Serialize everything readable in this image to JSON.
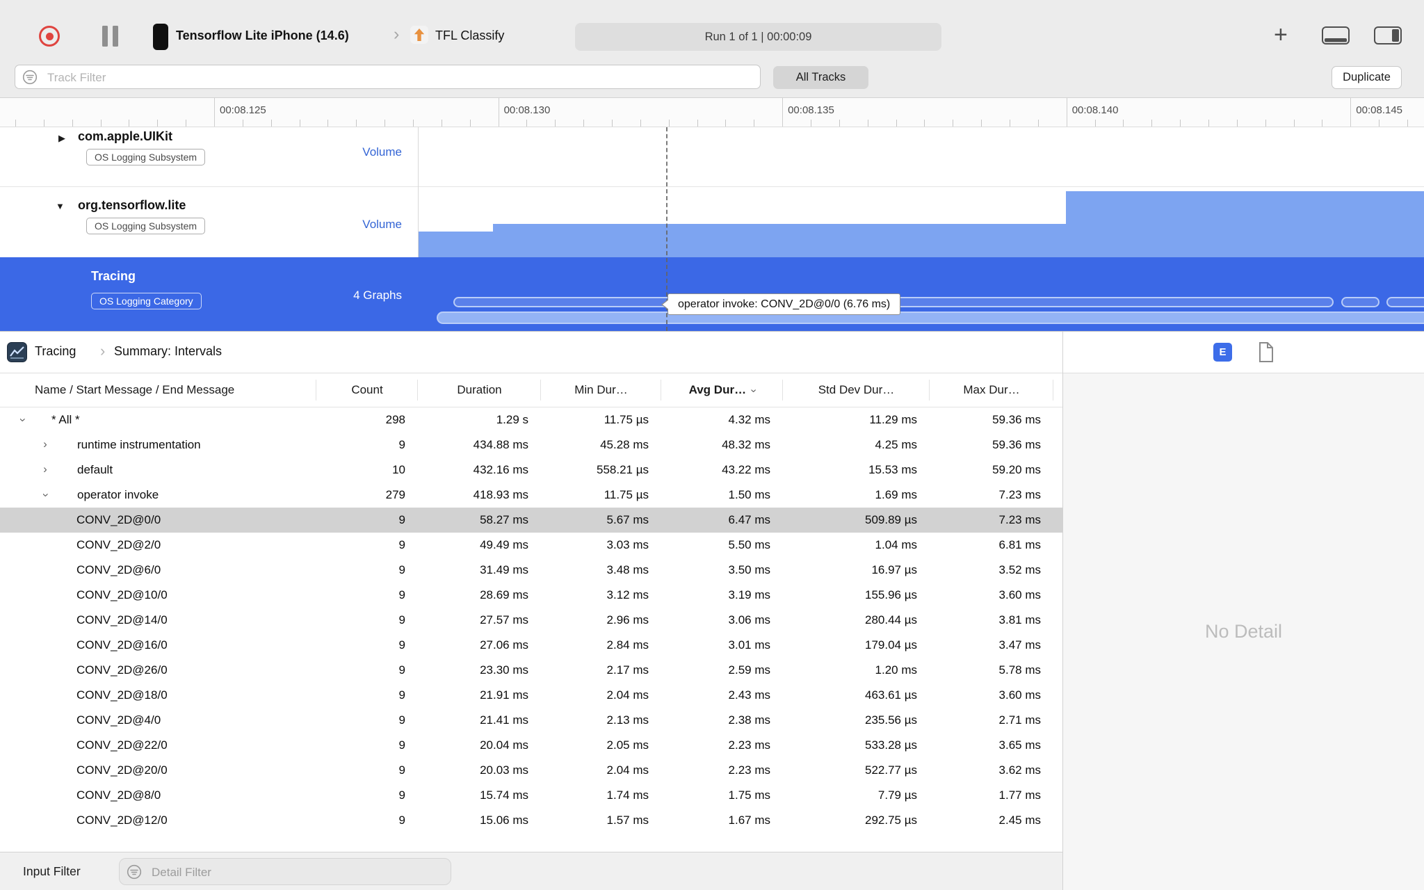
{
  "toolbar": {
    "device_name": "Tensorflow Lite iPhone (14.6)",
    "target_name": "TFL Classify",
    "run_status": "Run 1 of 1   |   00:00:09"
  },
  "filter_bar": {
    "track_filter_placeholder": "Track Filter",
    "all_tracks_label": "All Tracks",
    "duplicate_label": "Duplicate"
  },
  "ruler": {
    "labels": [
      "00:08.125",
      "00:08.130",
      "00:08.135",
      "00:08.140",
      "00:08.145"
    ]
  },
  "tracks": [
    {
      "name": "com.apple.UIKit",
      "badge": "OS Logging Subsystem",
      "meta": "Volume",
      "state": "collapsed",
      "selected": false
    },
    {
      "name": "org.tensorflow.lite",
      "badge": "OS Logging Subsystem",
      "meta": "Volume",
      "state": "expanded",
      "selected": false
    },
    {
      "name": "Tracing",
      "badge": "OS Logging Category",
      "meta": "4 Graphs",
      "state": "none",
      "selected": true
    }
  ],
  "timeline_tooltip": "operator invoke: CONV_2D@0/0 (6.76 ms)",
  "detail_pane": {
    "breadcrumb": {
      "instrument": "Tracing",
      "page": "Summary: Intervals"
    },
    "extended_detail_button": "E",
    "no_detail_text": "No Detail"
  },
  "table": {
    "columns": [
      "Name / Start Message / End Message",
      "Count",
      "Duration",
      "Min Dur…",
      "Avg Dur…",
      "Std Dev Dur…",
      "Max Dur…"
    ],
    "sorted_column_index": 4,
    "rows": [
      {
        "name": "* All *",
        "level": 0,
        "disclosure": "open",
        "selected": false,
        "values": [
          "298",
          "1.29 s",
          "11.75 µs",
          "4.32 ms",
          "11.29 ms",
          "59.36 ms"
        ]
      },
      {
        "name": "runtime instrumentation",
        "level": 1,
        "disclosure": "closed",
        "selected": false,
        "values": [
          "9",
          "434.88 ms",
          "45.28 ms",
          "48.32 ms",
          "4.25 ms",
          "59.36 ms"
        ]
      },
      {
        "name": "default",
        "level": 1,
        "disclosure": "closed",
        "selected": false,
        "values": [
          "10",
          "432.16 ms",
          "558.21 µs",
          "43.22 ms",
          "15.53 ms",
          "59.20 ms"
        ]
      },
      {
        "name": "operator invoke",
        "level": 1,
        "disclosure": "open",
        "selected": false,
        "values": [
          "279",
          "418.93 ms",
          "11.75 µs",
          "1.50 ms",
          "1.69 ms",
          "7.23 ms"
        ]
      },
      {
        "name": "CONV_2D@0/0",
        "level": 2,
        "disclosure": null,
        "selected": true,
        "values": [
          "9",
          "58.27 ms",
          "5.67 ms",
          "6.47 ms",
          "509.89 µs",
          "7.23 ms"
        ]
      },
      {
        "name": "CONV_2D@2/0",
        "level": 2,
        "disclosure": null,
        "selected": false,
        "values": [
          "9",
          "49.49 ms",
          "3.03 ms",
          "5.50 ms",
          "1.04 ms",
          "6.81 ms"
        ]
      },
      {
        "name": "CONV_2D@6/0",
        "level": 2,
        "disclosure": null,
        "selected": false,
        "values": [
          "9",
          "31.49 ms",
          "3.48 ms",
          "3.50 ms",
          "16.97 µs",
          "3.52 ms"
        ]
      },
      {
        "name": "CONV_2D@10/0",
        "level": 2,
        "disclosure": null,
        "selected": false,
        "values": [
          "9",
          "28.69 ms",
          "3.12 ms",
          "3.19 ms",
          "155.96 µs",
          "3.60 ms"
        ]
      },
      {
        "name": "CONV_2D@14/0",
        "level": 2,
        "disclosure": null,
        "selected": false,
        "values": [
          "9",
          "27.57 ms",
          "2.96 ms",
          "3.06 ms",
          "280.44 µs",
          "3.81 ms"
        ]
      },
      {
        "name": "CONV_2D@16/0",
        "level": 2,
        "disclosure": null,
        "selected": false,
        "values": [
          "9",
          "27.06 ms",
          "2.84 ms",
          "3.01 ms",
          "179.04 µs",
          "3.47 ms"
        ]
      },
      {
        "name": "CONV_2D@26/0",
        "level": 2,
        "disclosure": null,
        "selected": false,
        "values": [
          "9",
          "23.30 ms",
          "2.17 ms",
          "2.59 ms",
          "1.20 ms",
          "5.78 ms"
        ]
      },
      {
        "name": "CONV_2D@18/0",
        "level": 2,
        "disclosure": null,
        "selected": false,
        "values": [
          "9",
          "21.91 ms",
          "2.04 ms",
          "2.43 ms",
          "463.61 µs",
          "3.60 ms"
        ]
      },
      {
        "name": "CONV_2D@4/0",
        "level": 2,
        "disclosure": null,
        "selected": false,
        "values": [
          "9",
          "21.41 ms",
          "2.13 ms",
          "2.38 ms",
          "235.56 µs",
          "2.71 ms"
        ]
      },
      {
        "name": "CONV_2D@22/0",
        "level": 2,
        "disclosure": null,
        "selected": false,
        "values": [
          "9",
          "20.04 ms",
          "2.05 ms",
          "2.23 ms",
          "533.28 µs",
          "3.65 ms"
        ]
      },
      {
        "name": "CONV_2D@20/0",
        "level": 2,
        "disclosure": null,
        "selected": false,
        "values": [
          "9",
          "20.03 ms",
          "2.04 ms",
          "2.23 ms",
          "522.77 µs",
          "3.62 ms"
        ]
      },
      {
        "name": "CONV_2D@8/0",
        "level": 2,
        "disclosure": null,
        "selected": false,
        "values": [
          "9",
          "15.74 ms",
          "1.74 ms",
          "1.75 ms",
          "7.79 µs",
          "1.77 ms"
        ]
      },
      {
        "name": "CONV_2D@12/0",
        "level": 2,
        "disclosure": null,
        "selected": false,
        "values": [
          "9",
          "15.06 ms",
          "1.57 ms",
          "1.67 ms",
          "292.75 µs",
          "2.45 ms"
        ]
      }
    ]
  },
  "bottom_bar": {
    "input_filter_label": "Input Filter",
    "detail_filter_placeholder": "Detail Filter"
  }
}
